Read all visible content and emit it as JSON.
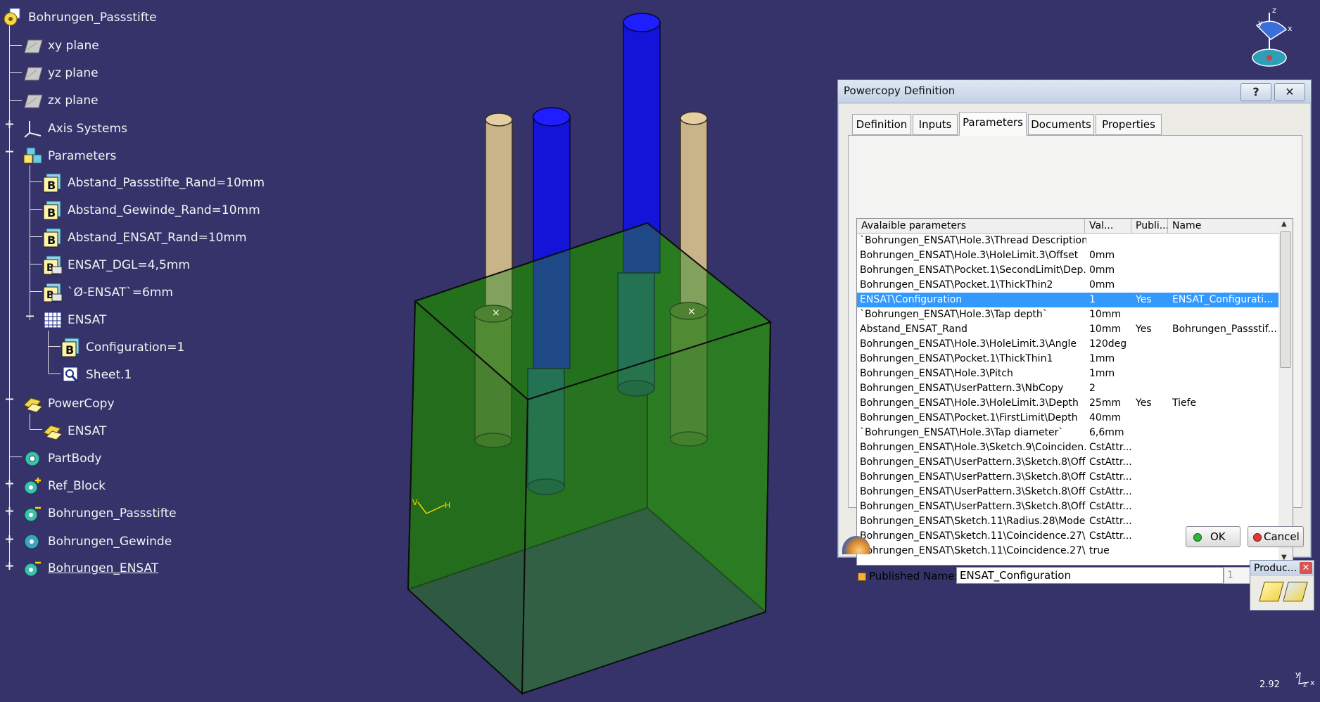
{
  "tree": {
    "root": "Bohrungen_Passstifte",
    "items": [
      {
        "label": "xy plane"
      },
      {
        "label": "yz plane"
      },
      {
        "label": "zx plane"
      },
      {
        "label": "Axis Systems"
      },
      {
        "label": "Parameters"
      },
      {
        "label": "Abstand_Passstifte_Rand=10mm"
      },
      {
        "label": "Abstand_Gewinde_Rand=10mm"
      },
      {
        "label": "Abstand_ENSAT_Rand=10mm"
      },
      {
        "label": "ENSAT_DGL=4,5mm"
      },
      {
        "label": "`Ø-ENSAT`=6mm"
      },
      {
        "label": "ENSAT"
      },
      {
        "label": "Configuration=1"
      },
      {
        "label": "Sheet.1"
      },
      {
        "label": "PowerCopy"
      },
      {
        "label": "ENSAT"
      },
      {
        "label": "PartBody"
      },
      {
        "label": "Ref_Block"
      },
      {
        "label": "Bohrungen_Passstifte"
      },
      {
        "label": "Bohrungen_Gewinde"
      },
      {
        "label": "Bohrungen_ENSAT"
      }
    ]
  },
  "viewport": {
    "axis_labels": {
      "h": "H",
      "v": "V"
    },
    "compass": {
      "z": "z",
      "y": "y",
      "x": "x"
    },
    "corner_axis": {
      "y": "y",
      "x": "x",
      "z": "z"
    },
    "zoom": "2.92",
    "colors": {
      "background": "#35336a",
      "block": "#1f6b1a",
      "pin": "#c9b48a",
      "rod": "#1414d8"
    }
  },
  "dialog": {
    "title": "Powercopy Definition",
    "help_button": "?",
    "close_button": "✕",
    "tabs": [
      "Definition",
      "Inputs",
      "Parameters",
      "Documents",
      "Properties"
    ],
    "active_tab": "Parameters",
    "columns": [
      "Avalaible parameters",
      "Val...",
      "Publi...",
      "Name"
    ],
    "rows": [
      {
        "param": "`Bohrungen_ENSAT\\Hole.3\\Thread Description`",
        "val": "",
        "pub": "",
        "name": ""
      },
      {
        "param": "Bohrungen_ENSAT\\Hole.3\\HoleLimit.3\\Offset",
        "val": "0mm",
        "pub": "",
        "name": ""
      },
      {
        "param": "Bohrungen_ENSAT\\Pocket.1\\SecondLimit\\Dep...",
        "val": "0mm",
        "pub": "",
        "name": ""
      },
      {
        "param": "Bohrungen_ENSAT\\Pocket.1\\ThickThin2",
        "val": "0mm",
        "pub": "",
        "name": ""
      },
      {
        "param": "ENSAT\\Configuration",
        "val": "1",
        "pub": "Yes",
        "name": "ENSAT_Configurati..."
      },
      {
        "param": "`Bohrungen_ENSAT\\Hole.3\\Tap depth`",
        "val": "10mm",
        "pub": "",
        "name": ""
      },
      {
        "param": "Abstand_ENSAT_Rand",
        "val": "10mm",
        "pub": "Yes",
        "name": "Bohrungen_Passstif..."
      },
      {
        "param": "Bohrungen_ENSAT\\Hole.3\\HoleLimit.3\\Angle",
        "val": "120deg",
        "pub": "",
        "name": ""
      },
      {
        "param": "Bohrungen_ENSAT\\Pocket.1\\ThickThin1",
        "val": "1mm",
        "pub": "",
        "name": ""
      },
      {
        "param": "Bohrungen_ENSAT\\Hole.3\\Pitch",
        "val": "1mm",
        "pub": "",
        "name": ""
      },
      {
        "param": "Bohrungen_ENSAT\\UserPattern.3\\NbCopy",
        "val": "2",
        "pub": "",
        "name": ""
      },
      {
        "param": "Bohrungen_ENSAT\\Hole.3\\HoleLimit.3\\Depth",
        "val": "25mm",
        "pub": "Yes",
        "name": "Tiefe"
      },
      {
        "param": "Bohrungen_ENSAT\\Pocket.1\\FirstLimit\\Depth",
        "val": "40mm",
        "pub": "",
        "name": ""
      },
      {
        "param": "`Bohrungen_ENSAT\\Hole.3\\Tap diameter`",
        "val": "6,6mm",
        "pub": "",
        "name": ""
      },
      {
        "param": "Bohrungen_ENSAT\\Hole.3\\Sketch.9\\Coinciden...",
        "val": "CstAttr...",
        "pub": "",
        "name": ""
      },
      {
        "param": "Bohrungen_ENSAT\\UserPattern.3\\Sketch.8\\Off...",
        "val": "CstAttr...",
        "pub": "",
        "name": ""
      },
      {
        "param": "Bohrungen_ENSAT\\UserPattern.3\\Sketch.8\\Off...",
        "val": "CstAttr...",
        "pub": "",
        "name": ""
      },
      {
        "param": "Bohrungen_ENSAT\\UserPattern.3\\Sketch.8\\Off...",
        "val": "CstAttr...",
        "pub": "",
        "name": ""
      },
      {
        "param": "Bohrungen_ENSAT\\UserPattern.3\\Sketch.8\\Off...",
        "val": "CstAttr...",
        "pub": "",
        "name": ""
      },
      {
        "param": "Bohrungen_ENSAT\\Sketch.11\\Radius.28\\Mode",
        "val": "CstAttr...",
        "pub": "",
        "name": ""
      },
      {
        "param": "Bohrungen_ENSAT\\Sketch.11\\Coincidence.27\\...",
        "val": "CstAttr...",
        "pub": "",
        "name": ""
      },
      {
        "param": "Bohrungen_ENSAT\\Sketch.11\\Coincidence.27\\...",
        "val": "true",
        "pub": "",
        "name": ""
      }
    ],
    "selected_row": 4,
    "published_label": "Published",
    "name_label": "Name:",
    "name_value": "ENSAT_Configuration",
    "value_field": "1",
    "ok": "OK",
    "cancel": "Cancel"
  },
  "product_toolbar": {
    "title": "Produc...",
    "close": "✕"
  }
}
